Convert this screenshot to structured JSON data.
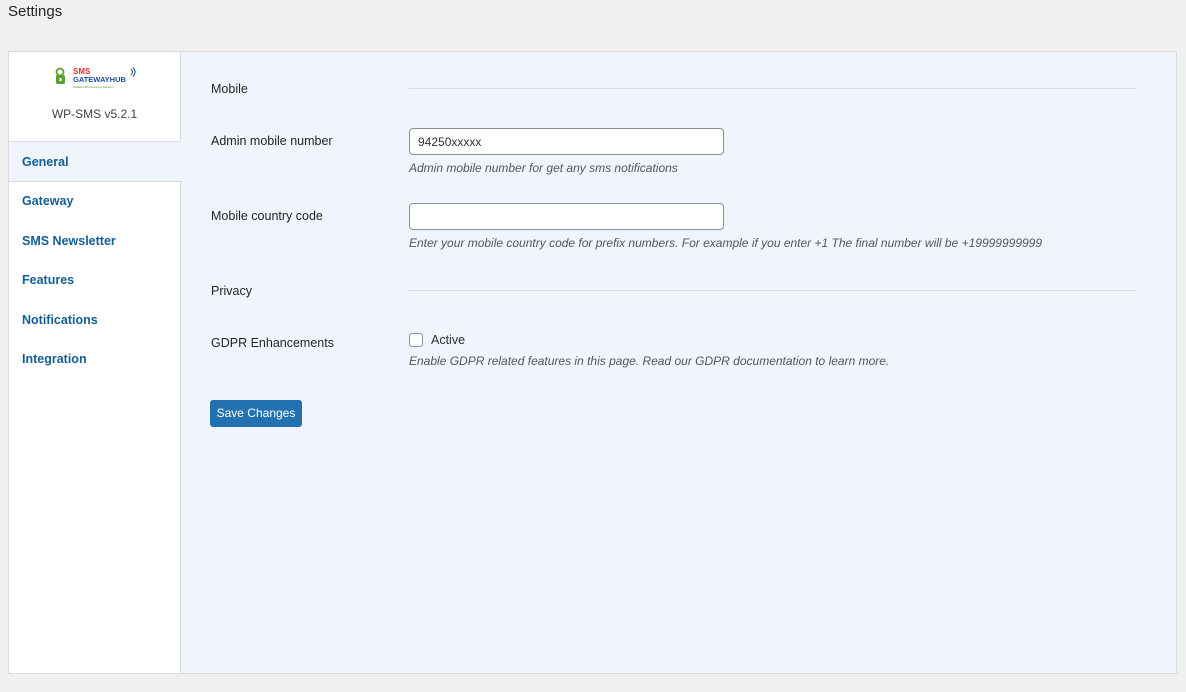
{
  "page": {
    "title": "Settings"
  },
  "sidebar": {
    "logo": {
      "line1": "SMS",
      "line2": "GATEWAYHUB",
      "tagline": "Reliable SMS Messaging Solutions"
    },
    "version": "WP-SMS v5.2.1",
    "items": [
      {
        "label": "General",
        "active": true
      },
      {
        "label": "Gateway"
      },
      {
        "label": "SMS Newsletter"
      },
      {
        "label": "Features"
      },
      {
        "label": "Notifications"
      },
      {
        "label": "Integration"
      }
    ]
  },
  "form": {
    "mobile_section": "Mobile",
    "admin_mobile": {
      "label": "Admin mobile number",
      "value": "94250xxxxx",
      "description": "Admin mobile number for get any sms notifications"
    },
    "country_code": {
      "label": "Mobile country code",
      "value": "",
      "description": "Enter your mobile country code for prefix numbers. For example if you enter +1 The final number will be +19999999999"
    },
    "privacy_section": "Privacy",
    "gdpr": {
      "label": "GDPR Enhancements",
      "checkbox_label": "Active",
      "checked": false,
      "description": "Enable GDPR related features in this page. Read our GDPR documentation to learn more."
    },
    "save_label": "Save Changes"
  },
  "colors": {
    "accent": "#2271b1",
    "link": "#135e96",
    "panel_bg": "#f0f4fd",
    "page_bg": "#f0f0f1",
    "logo_red": "#d63638",
    "logo_blue": "#1b4f9c",
    "logo_green": "#5aa02c"
  },
  "icons": {
    "logo": "sms-gateway-hub-logo"
  }
}
